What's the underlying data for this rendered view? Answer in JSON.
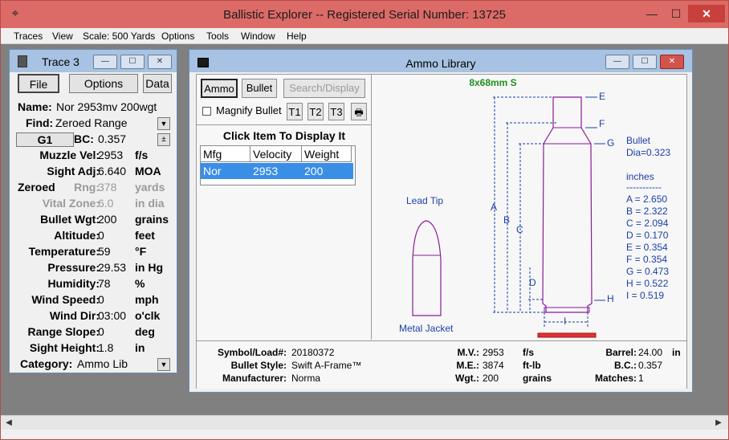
{
  "app": {
    "title": "Ballistic Explorer  --  Registered Serial Number: 13725",
    "icon": "app-icon",
    "window_controls": {
      "minimize": "—",
      "maximize": "☐",
      "close": "✕"
    }
  },
  "menu": [
    "Traces",
    "View",
    "Scale: 500 Yards",
    "Options",
    "Tools",
    "Window",
    "Help"
  ],
  "trace": {
    "title": "Trace 3",
    "tabs": {
      "file": "File",
      "options": "Options",
      "data": "Data"
    },
    "name_label": "Name:",
    "name_value": "Nor  2953mv 200wgt",
    "find_label": "Find:",
    "find_value": "Zeroed Range",
    "g1_label": "G1",
    "bc_label": "BC:",
    "bc_value": "0.357",
    "rows": [
      {
        "label": "Muzzle Vel:",
        "value": "2953",
        "unit": "f/s",
        "dim": false
      },
      {
        "label": "Sight Adj:",
        "value": "6.640",
        "unit": "MOA",
        "dim": false
      },
      {
        "label": "Rng:",
        "value": "378",
        "unit": "yards",
        "dim": true,
        "prefix": "Zeroed"
      },
      {
        "label": "Vital Zone:",
        "value": "6.0",
        "unit": "in dia",
        "dim": true
      },
      {
        "label": "Bullet Wgt:",
        "value": "200",
        "unit": "grains",
        "dim": false
      },
      {
        "label": "Altitude:",
        "value": "0",
        "unit": "feet",
        "dim": false
      },
      {
        "label": "Temperature:",
        "value": "59",
        "unit": "°F",
        "dim": false
      },
      {
        "label": "Pressure:",
        "value": "29.53",
        "unit": "in Hg",
        "dim": false
      },
      {
        "label": "Humidity:",
        "value": "78",
        "unit": "%",
        "dim": false
      },
      {
        "label": "Wind Speed:",
        "value": "0",
        "unit": "mph",
        "dim": false
      },
      {
        "label": "Wind Dir:",
        "value": "03:00",
        "unit": "o'clk",
        "dim": false
      },
      {
        "label": "Range Slope:",
        "value": "0",
        "unit": "deg",
        "dim": false
      },
      {
        "label": "Sight Height:",
        "value": "1.8",
        "unit": "in",
        "dim": false
      }
    ],
    "category_label": "Category:",
    "category_value": "Ammo Lib"
  },
  "ammo": {
    "title": "Ammo Library",
    "buttons": {
      "ammo": "Ammo",
      "bullet": "Bullet",
      "search": "Search/Display",
      "t1": "T1",
      "t2": "T2",
      "t3": "T3",
      "print": "🖶"
    },
    "magnify_label": "Magnify Bullet",
    "click_label": "Click Item To Display It",
    "table": {
      "headers": [
        "Mfg",
        "Velocity",
        "Weight"
      ],
      "rows": [
        [
          "Nor",
          "2953",
          "200"
        ]
      ]
    },
    "cartridge": "8x68mm S",
    "lead_tip": "Lead Tip",
    "metal_jacket": "Metal Jacket",
    "bullet_label": "Bullet",
    "bullet_dia": "Dia=0.323",
    "units": "inches",
    "dashes": "-----------",
    "dims": [
      "A = 2.650",
      "B = 2.322",
      "C = 2.094",
      "D = 0.170",
      "E = 0.354",
      "F = 0.354",
      "G = 0.473",
      "H = 0.522",
      "I = 0.519"
    ],
    "letters": {
      "a": "A",
      "b": "B",
      "c": "C",
      "d": "D",
      "e": "E",
      "f": "F",
      "g": "G",
      "h": "H",
      "i": "I"
    },
    "info": {
      "symbol_label": "Symbol/Load#:",
      "symbol": "20180372",
      "style_label": "Bullet Style:",
      "style": "Swift A-Frame™",
      "mfr_label": "Manufacturer:",
      "mfr": "Norma",
      "mv_label": "M.V.:",
      "mv": "2953",
      "mv_unit": "f/s",
      "me_label": "M.E.:",
      "me": "3874",
      "me_unit": "ft-lb",
      "wgt_label": "Wgt.:",
      "wgt": "200",
      "wgt_unit": "grains",
      "barrel_label": "Barrel:",
      "barrel": "24.00",
      "barrel_unit": "in",
      "bc_label": "B.C.:",
      "bc": "0.357",
      "matches_label": "Matches:",
      "matches": "1"
    }
  }
}
